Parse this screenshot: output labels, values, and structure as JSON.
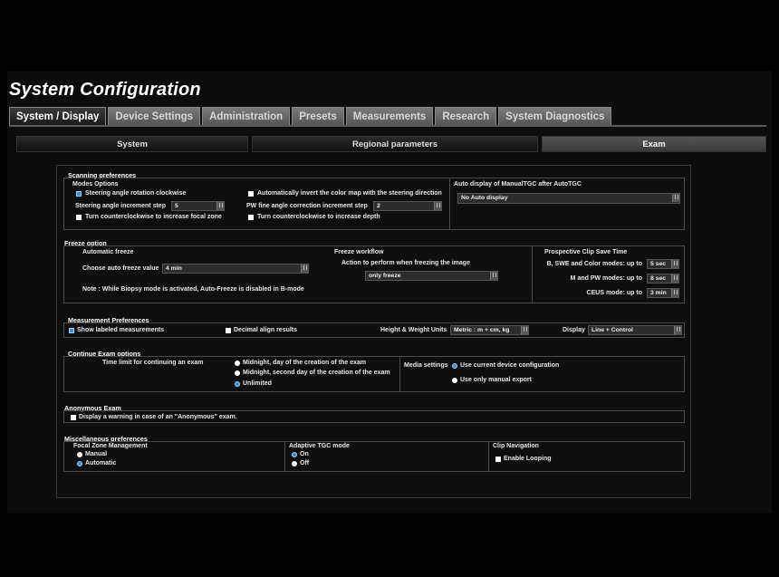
{
  "window": {
    "title": "System Configuration"
  },
  "tabs": [
    "System / Display",
    "Device Settings",
    "Administration",
    "Presets",
    "Measurements",
    "Research",
    "System Diagnostics"
  ],
  "subtabs": [
    "System",
    "Regional parameters",
    "Exam"
  ],
  "scanning": {
    "title": "Scanning preferences",
    "modes_title": "Modes Options",
    "steer_cw": "Steering angle rotation clockwise",
    "steer_inc_label": "Steering angle increment step",
    "steer_inc_value": "5",
    "ccw_focal": "Turn counterclockwise to increase focal zone",
    "auto_invert": "Automatically invert the color map with the steering direction",
    "pw_fine_label": "PW fine angle correction increment step",
    "pw_fine_value": "2",
    "ccw_depth": "Turn counterclockwise to increase depth",
    "auto_display_title": "Auto display of ManualTGC after AutoTGC",
    "auto_display_value": "No Auto display"
  },
  "freeze": {
    "title": "Freeze option",
    "auto_freeze": "Automatic freeze",
    "choose_label": "Choose auto freeze value",
    "choose_value": "4 min",
    "note": "Note : While Biopsy mode is activated, Auto-Freeze is disabled in B-mode",
    "workflow_title": "Freeze workflow",
    "action_label": "Action to perform when freezing the image",
    "action_value": "only freeze",
    "clip_title": "Prospective Clip Save Time",
    "clip_b_label": "B, SWE and Color modes: up to",
    "clip_b_value": "5 sec",
    "clip_m_label": "M and PW modes: up to",
    "clip_m_value": "8 sec",
    "clip_ceus_label": "CEUS mode: up to",
    "clip_ceus_value": "3 min"
  },
  "measurement": {
    "title": "Measurement Preferences",
    "show_labeled": "Show labeled measurements",
    "decimal_align": "Decimal align results",
    "units_label": "Height & Weight Units",
    "units_value": "Metric : m + cm, kg",
    "display_label": "Display",
    "display_value": "Line + Control"
  },
  "continue_exam": {
    "title": "Continue Exam options",
    "time_limit_label": "Time limit for continuing an exam",
    "opt1": "Midnight, day of the creation of the exam",
    "opt2": "Midnight, second day of the creation of the exam",
    "opt3": "Unlimited",
    "media_label": "Media settings",
    "media_opt1": "Use current device configuration",
    "media_opt2": "Use only manual export"
  },
  "anonymous": {
    "title": "Anonymous Exam",
    "warning": "Display a warning in case of an \"Anonymous\" exam."
  },
  "misc": {
    "title": "Miscellaneous preferences",
    "focal_title": "Focal Zone Management",
    "focal_manual": "Manual",
    "focal_auto": "Automatic",
    "tgc_title": "Adaptive TGC mode",
    "tgc_on": "On",
    "tgc_off": "Off",
    "clip_nav_title": "Clip Navigation",
    "enable_looping": "Enable Looping"
  }
}
